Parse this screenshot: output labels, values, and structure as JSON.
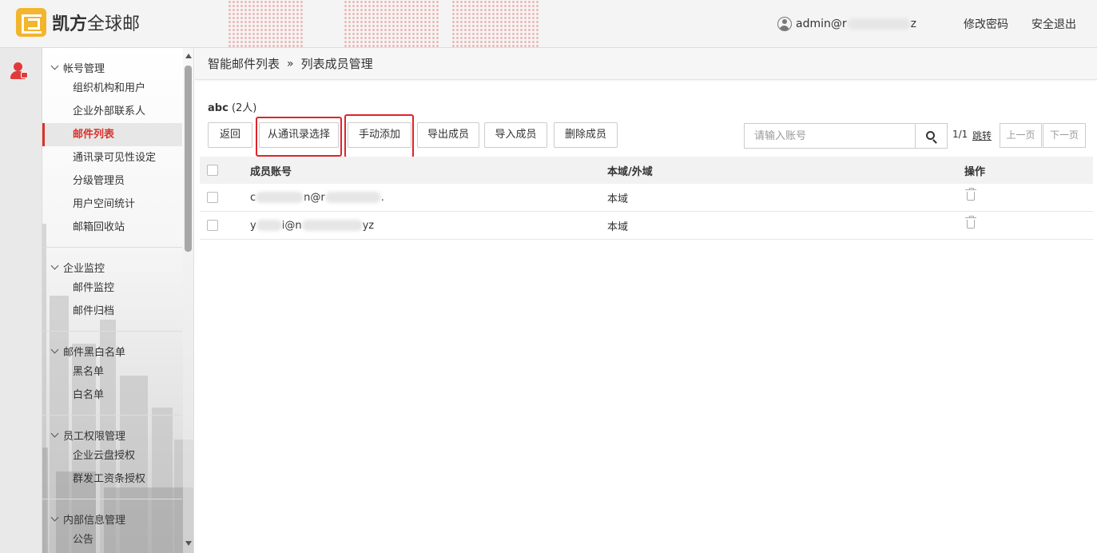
{
  "app": {
    "logo_text_bold": "凯方",
    "logo_text": "全球邮"
  },
  "header": {
    "user_prefix": "admin@r",
    "user_suffix": "z",
    "change_password": "修改密码",
    "logout": "安全退出"
  },
  "sidebar": {
    "groups": [
      {
        "title": "帐号管理",
        "items": [
          "组织机构和用户",
          "企业外部联系人",
          "邮件列表",
          "通讯录可见性设定",
          "分级管理员",
          "用户空间统计",
          "邮箱回收站"
        ]
      },
      {
        "title": "企业监控",
        "items": [
          "邮件监控",
          "邮件归档"
        ]
      },
      {
        "title": "邮件黑白名单",
        "items": [
          "黑名单",
          "白名单"
        ]
      },
      {
        "title": "员工权限管理",
        "items": [
          "企业云盘授权",
          "群发工资条授权"
        ]
      },
      {
        "title": "内部信息管理",
        "items": [
          "公告"
        ]
      }
    ],
    "active_item": "邮件列表"
  },
  "breadcrumb": {
    "parent": "智能邮件列表",
    "separator": "»",
    "current": "列表成员管理"
  },
  "list": {
    "name": "abc",
    "count": "(2人)"
  },
  "toolbar": {
    "back": "返回",
    "select_from_contacts": "从通讯录选择",
    "manual_add": "手动添加",
    "export_members": "导出成员",
    "import_members": "导入成员",
    "delete_members": "删除成员"
  },
  "search": {
    "placeholder": "请输入账号"
  },
  "pager": {
    "page_info": "1/1",
    "jump": "跳转",
    "prev": "上一页",
    "next": "下一页"
  },
  "table": {
    "headers": {
      "account": "成员账号",
      "domain": "本域/外域",
      "action": "操作"
    },
    "rows": [
      {
        "account_start": "c",
        "account_mid": "n@r",
        "account_end": ".",
        "domain": "本域"
      },
      {
        "account_start": "y",
        "account_mid": "i@n",
        "account_end": "yz",
        "domain": "本域"
      }
    ]
  },
  "colors": {
    "accent_red": "#d9322b",
    "highlight_box": "#e0242a",
    "logo_yellow": "#f3b52e"
  }
}
